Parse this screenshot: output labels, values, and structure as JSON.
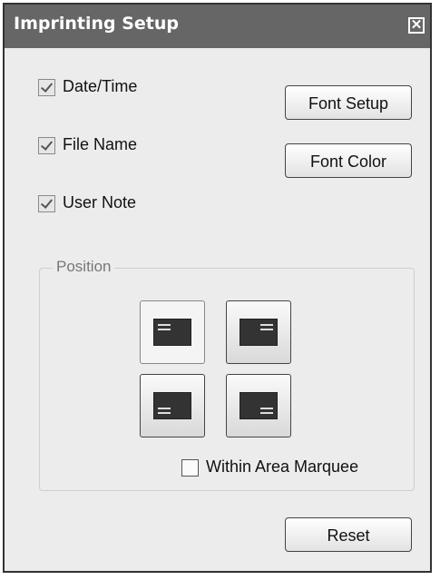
{
  "window": {
    "title": "Imprinting Setup"
  },
  "options": [
    {
      "label": "Date/Time",
      "checked": true
    },
    {
      "label": "File Name",
      "checked": true
    },
    {
      "label": "User Note",
      "checked": true
    }
  ],
  "buttons": {
    "font_setup": "Font Setup",
    "font_color": "Font Color",
    "reset": "Reset"
  },
  "position": {
    "legend": "Position",
    "selected": "top-left",
    "options": [
      "top-left",
      "top-right",
      "bottom-left",
      "bottom-right"
    ],
    "within_area_marquee": {
      "label": "Within Area Marquee",
      "checked": false
    }
  },
  "icons": {
    "close": "close-icon"
  }
}
